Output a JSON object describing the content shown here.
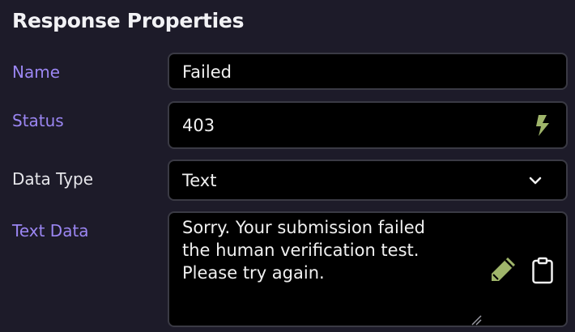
{
  "panel": {
    "title": "Response Properties"
  },
  "fields": {
    "name": {
      "label": "Name",
      "value": "Failed"
    },
    "status": {
      "label": "Status",
      "value": "403",
      "action_icon": "lightning-icon"
    },
    "data_type": {
      "label": "Data Type",
      "value": "Text",
      "dropdown_icon": "chevron-down-icon"
    },
    "text_data": {
      "label": "Text Data",
      "value": "Sorry. Your submission failed\nthe human verification test.\nPlease try again.",
      "edit_icon": "pencil-icon",
      "copy_icon": "clipboard-icon"
    }
  },
  "colors": {
    "background": "#1d1b29",
    "accent_label": "#9b86f2",
    "icon_green": "#9fb56a",
    "field_bg": "#000000"
  }
}
